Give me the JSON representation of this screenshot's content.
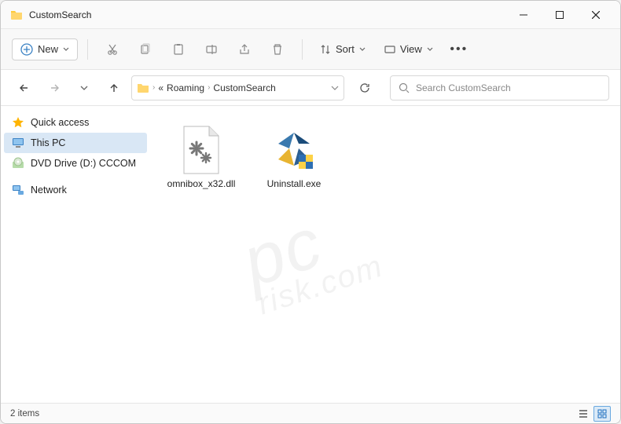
{
  "window": {
    "title": "CustomSearch"
  },
  "toolbar": {
    "new_label": "New",
    "sort_label": "Sort",
    "view_label": "View"
  },
  "breadcrumb": {
    "segments": [
      "Roaming",
      "CustomSearch"
    ],
    "ellipsis": "«"
  },
  "search": {
    "placeholder": "Search CustomSearch"
  },
  "sidebar": {
    "items": [
      {
        "label": "Quick access",
        "icon": "star"
      },
      {
        "label": "This PC",
        "icon": "monitor",
        "selected": true
      },
      {
        "label": "DVD Drive (D:) CCCOM",
        "icon": "disc"
      },
      {
        "label": "Network",
        "icon": "network"
      }
    ]
  },
  "files": [
    {
      "name": "omnibox_x32.dll",
      "type": "dll"
    },
    {
      "name": "Uninstall.exe",
      "type": "exe"
    }
  ],
  "status": {
    "count_text": "2 items"
  },
  "watermark": {
    "line1": "pc",
    "line2": "risk.com"
  }
}
